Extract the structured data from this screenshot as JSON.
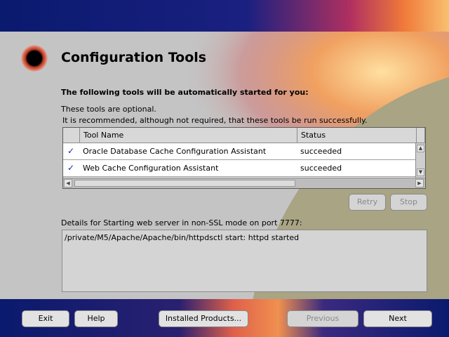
{
  "page": {
    "title": "Configuration Tools",
    "subtitle": "The following tools will be automatically started for you:",
    "line1": "These tools are optional.",
    "line2": "It is recommended, although not required, that these tools be run successfully."
  },
  "table": {
    "columns": [
      "Tool Name",
      "Status"
    ],
    "rows": [
      {
        "checked": true,
        "check_glyph": "✓",
        "name": "Oracle Database Cache Configuration Assistant",
        "status": "succeeded"
      },
      {
        "checked": true,
        "check_glyph": "✓",
        "name": "Web Cache Configuration Assistant",
        "status": "succeeded"
      }
    ]
  },
  "actions": {
    "retry": "Retry",
    "stop": "Stop"
  },
  "details": {
    "label": "Details for Starting web server in non-SSL mode on port 7777:",
    "text": "/private/M5/Apache/Apache/bin/httpdsctl start: httpd started"
  },
  "footer": {
    "exit": "Exit",
    "help": "Help",
    "installed_products": "Installed Products...",
    "previous": "Previous",
    "next": "Next"
  },
  "icons": {
    "logo": "oracle-installer-logo-icon",
    "scroll_up": "scroll-up-icon",
    "scroll_down": "scroll-down-icon",
    "scroll_left": "scroll-left-icon",
    "scroll_right": "scroll-right-icon"
  },
  "colors": {
    "top_band": "#0a1a6e",
    "panel": "#c4c4c4",
    "olive": "#a8a484",
    "check": "#1a2a9a"
  }
}
